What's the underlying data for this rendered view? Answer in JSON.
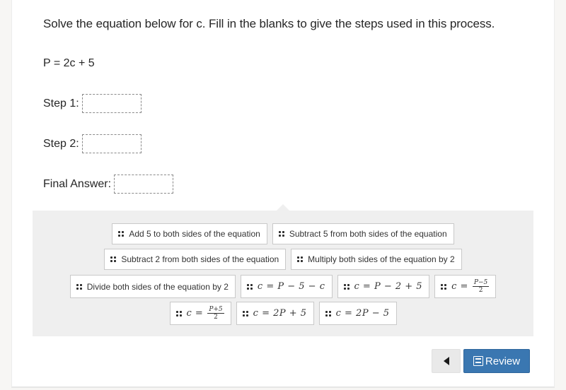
{
  "question": {
    "prompt": "Solve the equation below for c. Fill in the blanks to give the steps used in this process.",
    "equation": "P = 2c + 5"
  },
  "blanks": [
    {
      "label": "Step 1:",
      "value": ""
    },
    {
      "label": "Step 2:",
      "value": ""
    },
    {
      "label": "Final Answer:",
      "value": ""
    }
  ],
  "tiles": {
    "add5": "Add 5 to both sides of the equation",
    "sub5": "Subtract 5 from both sides of the equation",
    "sub2": "Subtract 2 from both sides of the equation",
    "mul2": "Multiply both sides of the equation by 2",
    "div2": "Divide both sides of the equation by 2",
    "eq_c_p_5_c": {
      "lhs": "c",
      "op": "=",
      "rhs": "P − 5 − c"
    },
    "eq_c_p_2_5": {
      "lhs": "c",
      "op": "=",
      "rhs": "P − 2 + 5"
    },
    "eq_c_pm5_2": {
      "lhs": "c",
      "op": "=",
      "num": "P−5",
      "den": "2"
    },
    "eq_c_pp5_2": {
      "lhs": "c",
      "op": "=",
      "num": "P+5",
      "den": "2"
    },
    "eq_c_2p_p5": {
      "lhs": "c",
      "op": "=",
      "rhs": "2P + 5"
    },
    "eq_c_2p_m5": {
      "lhs": "c",
      "op": "=",
      "rhs": "2P − 5"
    }
  },
  "nav": {
    "back_icon": "triangle-left",
    "review_label": "Review",
    "review_icon": "review-list"
  },
  "colors": {
    "review_button": "#3a77b1",
    "bank_background": "#efefef"
  }
}
